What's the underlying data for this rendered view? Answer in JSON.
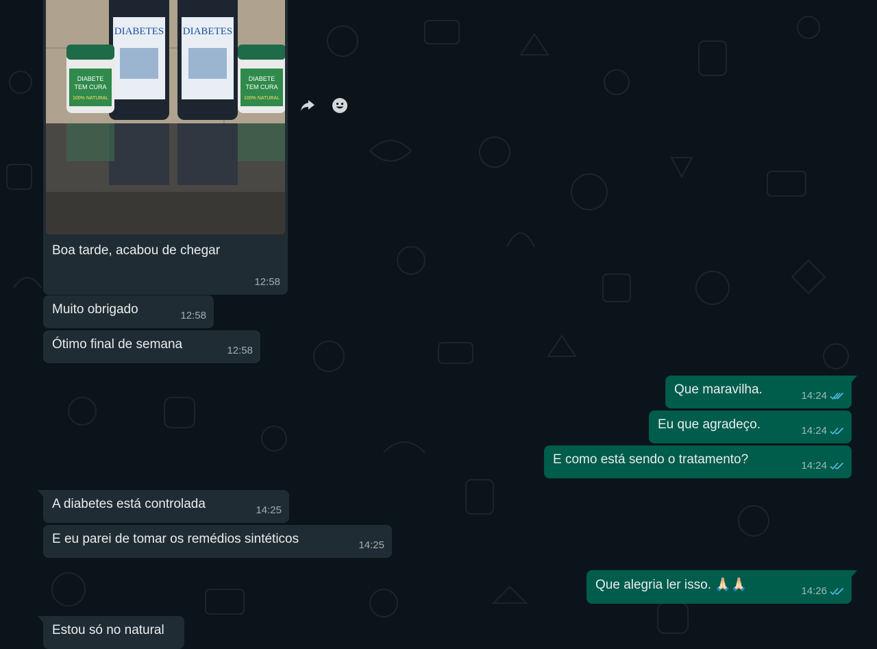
{
  "photo_message": {
    "caption": "Boa tarde, acabou de chegar",
    "time": "12:58",
    "product_labels": {
      "bottle_brand": "DIABETES",
      "jar_label_line1": "DIABETE",
      "jar_label_line2": "TEM CURA",
      "jar_label_line3": "100% NATURAL"
    }
  },
  "messages": [
    {
      "text": "Muito obrigado",
      "time": "12:58",
      "direction": "incoming"
    },
    {
      "text": "Ótimo final de semana",
      "time": "12:58",
      "direction": "incoming"
    },
    {
      "text": "Que maravilha.",
      "time": "14:24",
      "direction": "outgoing",
      "status": "read"
    },
    {
      "text": "Eu que agradeço.",
      "time": "14:24",
      "direction": "outgoing",
      "status": "read"
    },
    {
      "text": "E como está sendo o tratamento?",
      "time": "14:24",
      "direction": "outgoing",
      "status": "read"
    },
    {
      "text": "A diabetes está controlada",
      "time": "14:25",
      "direction": "incoming"
    },
    {
      "text": "E eu parei de tomar os remédios sintéticos",
      "time": "14:25",
      "direction": "incoming"
    },
    {
      "text": "Que alegria ler isso. 🙏🏻🙏🏻",
      "time": "14:26",
      "direction": "outgoing",
      "status": "read"
    },
    {
      "text": "Estou só no natural",
      "time": "",
      "direction": "incoming"
    }
  ],
  "actions": {
    "forward_icon": "forward-icon",
    "react_icon": "emoji-icon"
  },
  "colors": {
    "background": "#0b141a",
    "incoming_bubble": "#202c33",
    "outgoing_bubble": "#005c4b",
    "read_ticks": "#53bdeb"
  }
}
